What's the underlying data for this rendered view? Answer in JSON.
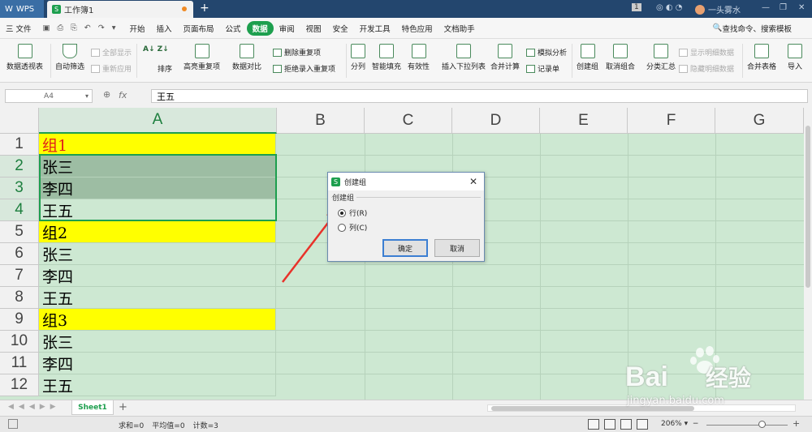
{
  "titlebar": {
    "app": "WPS",
    "doc_tab": "工作簿1",
    "badge": "1",
    "user": "一头雾水"
  },
  "menu": [
    "三 文件",
    "开始",
    "插入",
    "页面布局",
    "公式",
    "数据",
    "审阅",
    "视图",
    "安全",
    "开发工具",
    "特色应用",
    "文档助手"
  ],
  "menu_active": "数据",
  "search_cmd": "查找命令、搜索模板",
  "ribbon": {
    "pivot": "数据透视表",
    "autofilter": "自动筛选",
    "show_all": "全部显示",
    "reapply": "重新应用",
    "sort": "排序",
    "highlight_dup": "高亮重复项",
    "compare": "数据对比",
    "delete_dup": "删除重复项",
    "reject_dup": "拒绝录入重复项",
    "split": "分列",
    "smart_fill": "智能填充",
    "validity": "有效性",
    "insert_dropdown": "插入下拉列表",
    "merge_calc": "合并计算",
    "simulate": "模拟分析",
    "record": "记录单",
    "create_group": "创建组",
    "ungroup": "取消组合",
    "subtotal": "分类汇总",
    "show_detail": "显示明细数据",
    "hide_detail": "隐藏明细数据",
    "merge_table": "合并表格",
    "import": "导入"
  },
  "formula": {
    "cell_ref": "A4",
    "fx": "fx",
    "value": "王五"
  },
  "columns": [
    "A",
    "B",
    "C",
    "D",
    "E",
    "F",
    "G"
  ],
  "rows": [
    {
      "num": "1",
      "a": "组1"
    },
    {
      "num": "2",
      "a": "张三"
    },
    {
      "num": "3",
      "a": "李四"
    },
    {
      "num": "4",
      "a": "王五"
    },
    {
      "num": "5",
      "a": "组2"
    },
    {
      "num": "6",
      "a": "张三"
    },
    {
      "num": "7",
      "a": "李四"
    },
    {
      "num": "8",
      "a": "王五"
    },
    {
      "num": "9",
      "a": "组3"
    },
    {
      "num": "10",
      "a": "张三"
    },
    {
      "num": "11",
      "a": "李四"
    },
    {
      "num": "12",
      "a": "王五"
    }
  ],
  "colors": {
    "header_yellow": "#ffff00",
    "red_text": "#e0201a",
    "accent": "#1d9f4e",
    "sheet_bg": "#cde8d2"
  },
  "dialog": {
    "title": "创建组",
    "group_label": "创建组",
    "opt_row": "行(R)",
    "opt_col": "列(C)",
    "selected": "行(R)",
    "ok": "确定",
    "cancel": "取消"
  },
  "sheet_tab": "Sheet1",
  "status": {
    "sum": "求和=0",
    "avg": "平均值=0",
    "count": "计数=3",
    "zoom": "206%"
  },
  "watermark": {
    "brand": "Bai",
    "cn": "经验",
    "url": "jingyan.baidu.com"
  }
}
